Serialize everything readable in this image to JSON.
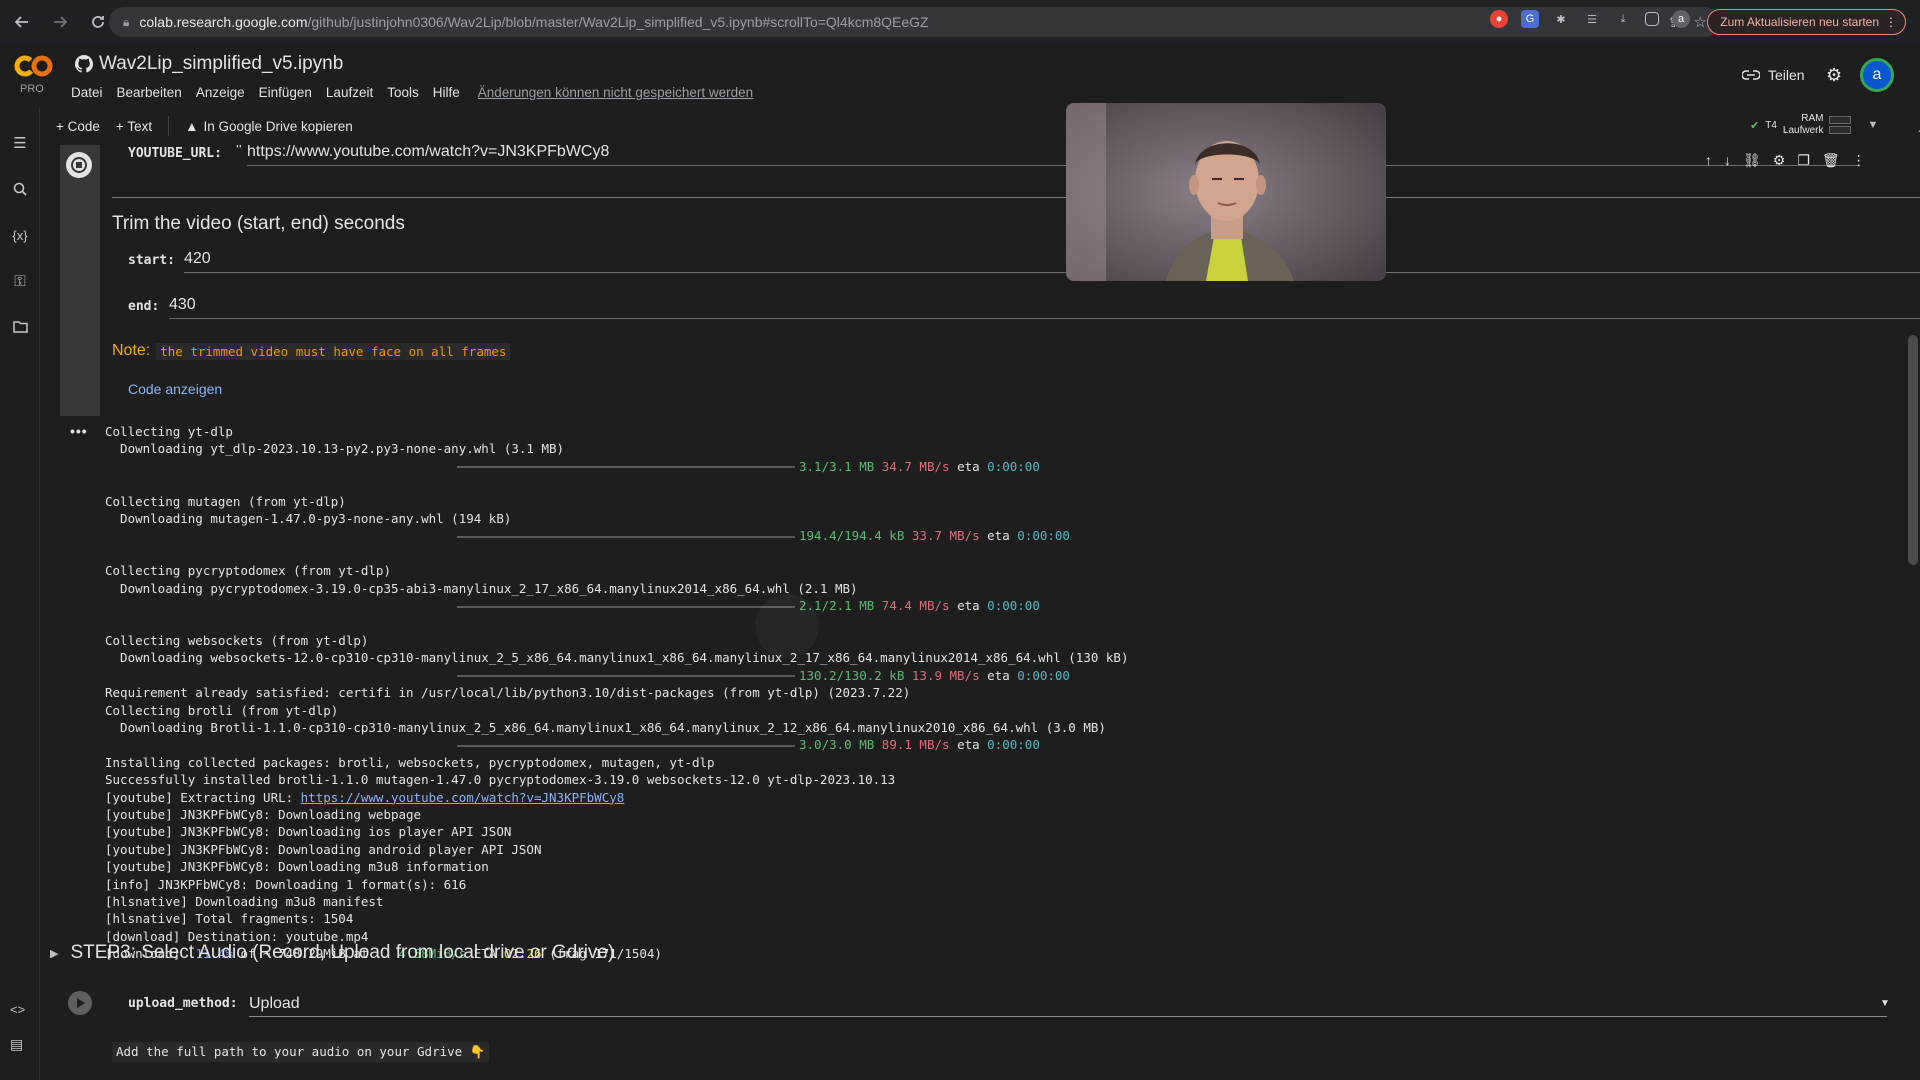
{
  "browser": {
    "url_domain": "colab.research.google.com",
    "url_path": "/github/justinjohn0306/Wav2Lip/blob/master/Wav2Lip_simplified_v5.ipynb#scrollTo=Ql4kcm8QEeGZ",
    "update_button": "Zum Aktualisieren neu starten",
    "profile_initial": "a"
  },
  "header": {
    "logo_pro": "PRO",
    "notebook_title": "Wav2Lip_simplified_v5.ipynb",
    "menu": [
      "Datei",
      "Bearbeiten",
      "Anzeige",
      "Einfügen",
      "Laufzeit",
      "Tools",
      "Hilfe"
    ],
    "unsaved_notice": "Änderungen können nicht gespeichert werden",
    "share_label": "Teilen",
    "avatar_initial": "a"
  },
  "toolbar": {
    "code_label": "+ Code",
    "text_label": "+ Text",
    "drive_copy_label": "In Google Drive kopieren",
    "runtime_gpu": "T4",
    "ram_label": "RAM",
    "disk_label": "Laufwerk"
  },
  "cell": {
    "youtube_label": "YOUTUBE_URL:",
    "youtube_value": "https://www.youtube.com/watch?v=JN3KPFbWCy8",
    "trim_heading": "Trim the video (start, end) seconds",
    "start_label": "start:",
    "start_value": "420",
    "end_label": "end:",
    "end_value": "430",
    "note_label": "Note:",
    "note_text": "the trimmed video must have face on all frames",
    "show_code": "Code anzeigen"
  },
  "output_lines": {
    "l1": "Collecting yt-dlp",
    "l2": "  Downloading yt_dlp-2023.10.13-py2.py3-none-any.whl (3.1 MB)",
    "p1_size": "3.1/3.1 MB",
    "p1_speed": "34.7 MB/s",
    "p1_eta_label": "eta",
    "p1_eta": "0:00:00",
    "l3": "Collecting mutagen (from yt-dlp)",
    "l4": "  Downloading mutagen-1.47.0-py3-none-any.whl (194 kB)",
    "p2_size": "194.4/194.4 kB",
    "p2_speed": "33.7 MB/s",
    "p2_eta": "0:00:00",
    "l5": "Collecting pycryptodomex (from yt-dlp)",
    "l6": "  Downloading pycryptodomex-3.19.0-cp35-abi3-manylinux_2_17_x86_64.manylinux2014_x86_64.whl (2.1 MB)",
    "p3_size": "2.1/2.1 MB",
    "p3_speed": "74.4 MB/s",
    "p3_eta": "0:00:00",
    "l7": "Collecting websockets (from yt-dlp)",
    "l8": "  Downloading websockets-12.0-cp310-cp310-manylinux_2_5_x86_64.manylinux1_x86_64.manylinux_2_17_x86_64.manylinux2014_x86_64.whl (130 kB)",
    "p4_size": "130.2/130.2 kB",
    "p4_speed": "13.9 MB/s",
    "p4_eta": "0:00:00",
    "l9": "Requirement already satisfied: certifi in /usr/local/lib/python3.10/dist-packages (from yt-dlp) (2023.7.22)",
    "l10": "Collecting brotli (from yt-dlp)",
    "l11": "  Downloading Brotli-1.1.0-cp310-cp310-manylinux_2_5_x86_64.manylinux1_x86_64.manylinux_2_12_x86_64.manylinux2010_x86_64.whl (3.0 MB)",
    "p5_size": "3.0/3.0 MB",
    "p5_speed": "89.1 MB/s",
    "p5_eta": "0:00:00",
    "l12": "Installing collected packages: brotli, websockets, pycryptodomex, mutagen, yt-dlp",
    "l13": "Successfully installed brotli-1.1.0 mutagen-1.47.0 pycryptodomex-3.19.0 websockets-12.0 yt-dlp-2023.10.13",
    "l14_prefix": "[youtube] Extracting URL: ",
    "l14_link": "https://www.youtube.com/watch?v=JN3KPFbWCy8",
    "l15": "[youtube] JN3KPFbWCy8: Downloading webpage",
    "l16": "[youtube] JN3KPFbWCy8: Downloading ios player API JSON",
    "l17": "[youtube] JN3KPFbWCy8: Downloading android player API JSON",
    "l18": "[youtube] JN3KPFbWCy8: Downloading m3u8 information",
    "l19": "[info] JN3KPFbWCy8: Downloading 1 format(s): 616",
    "l20": "[hlsnative] Downloading m3u8 manifest",
    "l21": "[hlsnative] Total fragments: 1504",
    "l22": "[download] Destination: youtube.mp4",
    "dl_prefix": "[download]  ",
    "dl_percent": "11.4%",
    "dl_of": " of ~ 748.29MiB at    ",
    "dl_speed": "4.58MiB/s",
    "dl_eta_label": " ETA ",
    "dl_eta": "02:26",
    "dl_frag": " (frag 171/1504)"
  },
  "step3": {
    "heading": "STEP3: Select Audio (Record, Upload from local drive or Gdrive)",
    "upload_label": "upload_method:",
    "upload_value": "Upload",
    "gdrive_note": "Add the full path to your audio on your Gdrive 👇"
  }
}
